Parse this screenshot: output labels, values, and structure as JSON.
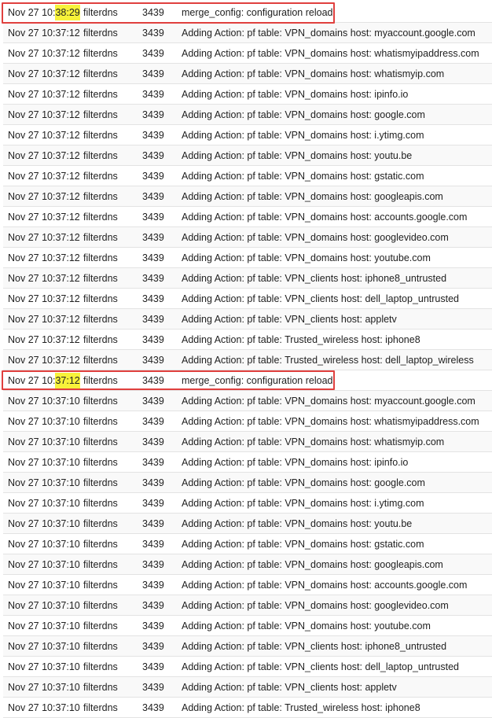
{
  "rows": [
    {
      "date": "Nov 27 10:",
      "time_hl": "38:29",
      "process": "filterdns",
      "pid": "3439",
      "message": "merge_config: configuration reload"
    },
    {
      "timestamp": "Nov 27 10:37:12",
      "process": "filterdns",
      "pid": "3439",
      "message": "Adding Action: pf table: VPN_domains host: myaccount.google.com"
    },
    {
      "timestamp": "Nov 27 10:37:12",
      "process": "filterdns",
      "pid": "3439",
      "message": "Adding Action: pf table: VPN_domains host: whatismyipaddress.com"
    },
    {
      "timestamp": "Nov 27 10:37:12",
      "process": "filterdns",
      "pid": "3439",
      "message": "Adding Action: pf table: VPN_domains host: whatismyip.com"
    },
    {
      "timestamp": "Nov 27 10:37:12",
      "process": "filterdns",
      "pid": "3439",
      "message": "Adding Action: pf table: VPN_domains host: ipinfo.io"
    },
    {
      "timestamp": "Nov 27 10:37:12",
      "process": "filterdns",
      "pid": "3439",
      "message": "Adding Action: pf table: VPN_domains host: google.com"
    },
    {
      "timestamp": "Nov 27 10:37:12",
      "process": "filterdns",
      "pid": "3439",
      "message": "Adding Action: pf table: VPN_domains host: i.ytimg.com"
    },
    {
      "timestamp": "Nov 27 10:37:12",
      "process": "filterdns",
      "pid": "3439",
      "message": "Adding Action: pf table: VPN_domains host: youtu.be"
    },
    {
      "timestamp": "Nov 27 10:37:12",
      "process": "filterdns",
      "pid": "3439",
      "message": "Adding Action: pf table: VPN_domains host: gstatic.com"
    },
    {
      "timestamp": "Nov 27 10:37:12",
      "process": "filterdns",
      "pid": "3439",
      "message": "Adding Action: pf table: VPN_domains host: googleapis.com"
    },
    {
      "timestamp": "Nov 27 10:37:12",
      "process": "filterdns",
      "pid": "3439",
      "message": "Adding Action: pf table: VPN_domains host: accounts.google.com"
    },
    {
      "timestamp": "Nov 27 10:37:12",
      "process": "filterdns",
      "pid": "3439",
      "message": "Adding Action: pf table: VPN_domains host: googlevideo.com"
    },
    {
      "timestamp": "Nov 27 10:37:12",
      "process": "filterdns",
      "pid": "3439",
      "message": "Adding Action: pf table: VPN_domains host: youtube.com"
    },
    {
      "timestamp": "Nov 27 10:37:12",
      "process": "filterdns",
      "pid": "3439",
      "message": "Adding Action: pf table: VPN_clients host: iphone8_untrusted"
    },
    {
      "timestamp": "Nov 27 10:37:12",
      "process": "filterdns",
      "pid": "3439",
      "message": "Adding Action: pf table: VPN_clients host: dell_laptop_untrusted"
    },
    {
      "timestamp": "Nov 27 10:37:12",
      "process": "filterdns",
      "pid": "3439",
      "message": "Adding Action: pf table: VPN_clients host: appletv"
    },
    {
      "timestamp": "Nov 27 10:37:12",
      "process": "filterdns",
      "pid": "3439",
      "message": "Adding Action: pf table: Trusted_wireless host: iphone8"
    },
    {
      "timestamp": "Nov 27 10:37:12",
      "process": "filterdns",
      "pid": "3439",
      "message": "Adding Action: pf table: Trusted_wireless host: dell_laptop_wireless"
    },
    {
      "date": "Nov 27 10:",
      "time_hl": "37:12",
      "process": "filterdns",
      "pid": "3439",
      "message": "merge_config: configuration reload"
    },
    {
      "timestamp": "Nov 27 10:37:10",
      "process": "filterdns",
      "pid": "3439",
      "message": "Adding Action: pf table: VPN_domains host: myaccount.google.com"
    },
    {
      "timestamp": "Nov 27 10:37:10",
      "process": "filterdns",
      "pid": "3439",
      "message": "Adding Action: pf table: VPN_domains host: whatismyipaddress.com"
    },
    {
      "timestamp": "Nov 27 10:37:10",
      "process": "filterdns",
      "pid": "3439",
      "message": "Adding Action: pf table: VPN_domains host: whatismyip.com"
    },
    {
      "timestamp": "Nov 27 10:37:10",
      "process": "filterdns",
      "pid": "3439",
      "message": "Adding Action: pf table: VPN_domains host: ipinfo.io"
    },
    {
      "timestamp": "Nov 27 10:37:10",
      "process": "filterdns",
      "pid": "3439",
      "message": "Adding Action: pf table: VPN_domains host: google.com"
    },
    {
      "timestamp": "Nov 27 10:37:10",
      "process": "filterdns",
      "pid": "3439",
      "message": "Adding Action: pf table: VPN_domains host: i.ytimg.com"
    },
    {
      "timestamp": "Nov 27 10:37:10",
      "process": "filterdns",
      "pid": "3439",
      "message": "Adding Action: pf table: VPN_domains host: youtu.be"
    },
    {
      "timestamp": "Nov 27 10:37:10",
      "process": "filterdns",
      "pid": "3439",
      "message": "Adding Action: pf table: VPN_domains host: gstatic.com"
    },
    {
      "timestamp": "Nov 27 10:37:10",
      "process": "filterdns",
      "pid": "3439",
      "message": "Adding Action: pf table: VPN_domains host: googleapis.com"
    },
    {
      "timestamp": "Nov 27 10:37:10",
      "process": "filterdns",
      "pid": "3439",
      "message": "Adding Action: pf table: VPN_domains host: accounts.google.com"
    },
    {
      "timestamp": "Nov 27 10:37:10",
      "process": "filterdns",
      "pid": "3439",
      "message": "Adding Action: pf table: VPN_domains host: googlevideo.com"
    },
    {
      "timestamp": "Nov 27 10:37:10",
      "process": "filterdns",
      "pid": "3439",
      "message": "Adding Action: pf table: VPN_domains host: youtube.com"
    },
    {
      "timestamp": "Nov 27 10:37:10",
      "process": "filterdns",
      "pid": "3439",
      "message": "Adding Action: pf table: VPN_clients host: iphone8_untrusted"
    },
    {
      "timestamp": "Nov 27 10:37:10",
      "process": "filterdns",
      "pid": "3439",
      "message": "Adding Action: pf table: VPN_clients host: dell_laptop_untrusted"
    },
    {
      "timestamp": "Nov 27 10:37:10",
      "process": "filterdns",
      "pid": "3439",
      "message": "Adding Action: pf table: VPN_clients host: appletv"
    },
    {
      "timestamp": "Nov 27 10:37:10",
      "process": "filterdns",
      "pid": "3439",
      "message": "Adding Action: pf table: Trusted_wireless host: iphone8"
    }
  ],
  "colors": {
    "highlight": "#f7f23a",
    "annotation_border": "#e0403e",
    "row_border": "#e3e3e3",
    "text": "#212121"
  }
}
